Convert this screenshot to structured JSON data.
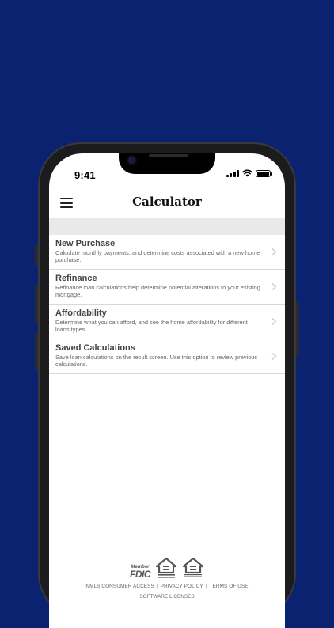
{
  "status_bar": {
    "time": "9:41"
  },
  "nav": {
    "title": "Calculator"
  },
  "items": [
    {
      "title": "New Purchase",
      "description": "Calculate monthly payments, and determine costs associated with a new home purchase."
    },
    {
      "title": "Refinance",
      "description": "Refinance loan calculations help determine potential alterations to your existing mortgage."
    },
    {
      "title": "Affordability",
      "description": "Determine what you can afford, and see the home affordability for different loans types."
    },
    {
      "title": "Saved Calculations",
      "description": "Save loan calculations on the result screen. Use this option to review previous calculations."
    }
  ],
  "footer": {
    "fdic_member": "Member",
    "fdic": "FDIC",
    "equal_housing_lender": "EQUAL HOUSING LENDER",
    "equal_housing_opportunity": "EQUAL HOUSING OPPORTUNITY",
    "links": [
      "NMLS CONSUMER ACCESS",
      "PRIVACY POLICY",
      "TERMS OF USE"
    ],
    "separator": "|",
    "software_licenses": "SOFTWARE LICENSES"
  },
  "colors": {
    "background": "#0b2270",
    "screen": "#ffffff",
    "band": "#e9e9e9"
  },
  "icons": {
    "menu": "hamburger-icon",
    "chevron": "chevron-right-icon",
    "signal": "cellular-signal-icon",
    "wifi": "wifi-icon",
    "battery": "battery-icon"
  }
}
